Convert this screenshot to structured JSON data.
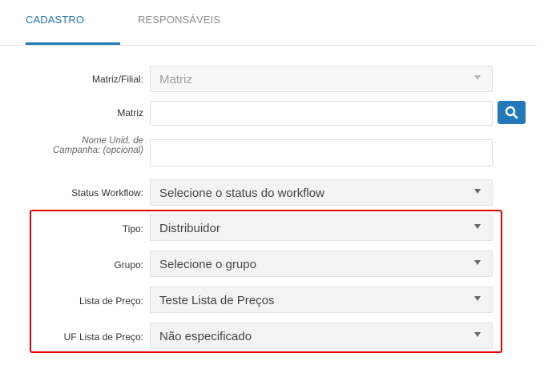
{
  "tabs": {
    "cadastro": "CADASTRO",
    "responsaveis": "RESPONSÁVEIS"
  },
  "form": {
    "matriz_filial": {
      "label": "Matriz/Filial:",
      "value": "Matriz"
    },
    "matriz": {
      "label": "Matriz",
      "value": ""
    },
    "nome_unid": {
      "label": "Nome Unid. de Campanha: (opcional)",
      "value": ""
    },
    "status_workflow": {
      "label": "Status Workflow:",
      "value": "Selecione o status do workflow"
    },
    "tipo": {
      "label": "Tipo:",
      "value": "Distribuidor"
    },
    "grupo": {
      "label": "Grupo:",
      "value": "Selecione o grupo"
    },
    "lista_preco": {
      "label": "Lista de Preço:",
      "value": "Teste Lista de Preços"
    },
    "uf_lista_preco": {
      "label": "UF Lista de Preço:",
      "value": "Não especificado"
    }
  },
  "colors": {
    "accent": "#1f77b4",
    "search_button": "#2378b9",
    "highlight_border": "#e10000"
  },
  "icons": {
    "search": "search-icon",
    "caret": "chevron-down-icon"
  }
}
